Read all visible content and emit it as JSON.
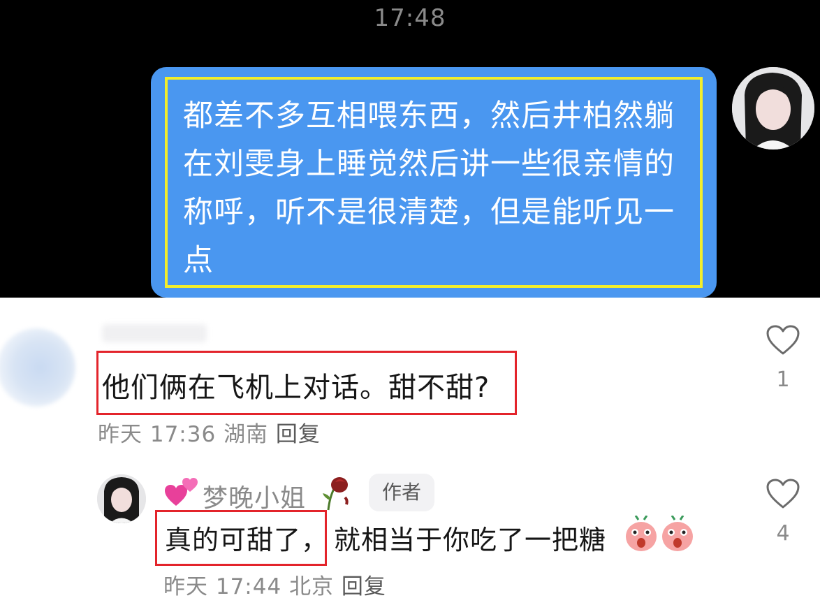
{
  "chat": {
    "time": "17:48",
    "message": "都差不多互相喂东西，然后井柏然躺在刘雯身上睡觉然后讲一些很亲情的称呼，听不是很清楚，但是能听见一点"
  },
  "comments": [
    {
      "text": "他们俩在飞机上对话。甜不甜?",
      "time": "昨天 17:36",
      "location": "湖南",
      "reply_label": "回复",
      "likes": "1"
    },
    {
      "username": "梦晚小姐",
      "badge": "作者",
      "text_highlight": "真的可甜了，",
      "text_rest": "就相当于你吃了一把糖",
      "time": "昨天 17:44",
      "location": "北京",
      "reply_label": "回复",
      "likes": "4"
    }
  ],
  "colors": {
    "bubble": "#4a97f0",
    "bubble_border": "#f3ee2a",
    "highlight_box": "#e3242b"
  },
  "icons": [
    "heart-outline-icon",
    "two-hearts-emoji",
    "wilted-rose-emoji",
    "pig-face-emoji"
  ]
}
